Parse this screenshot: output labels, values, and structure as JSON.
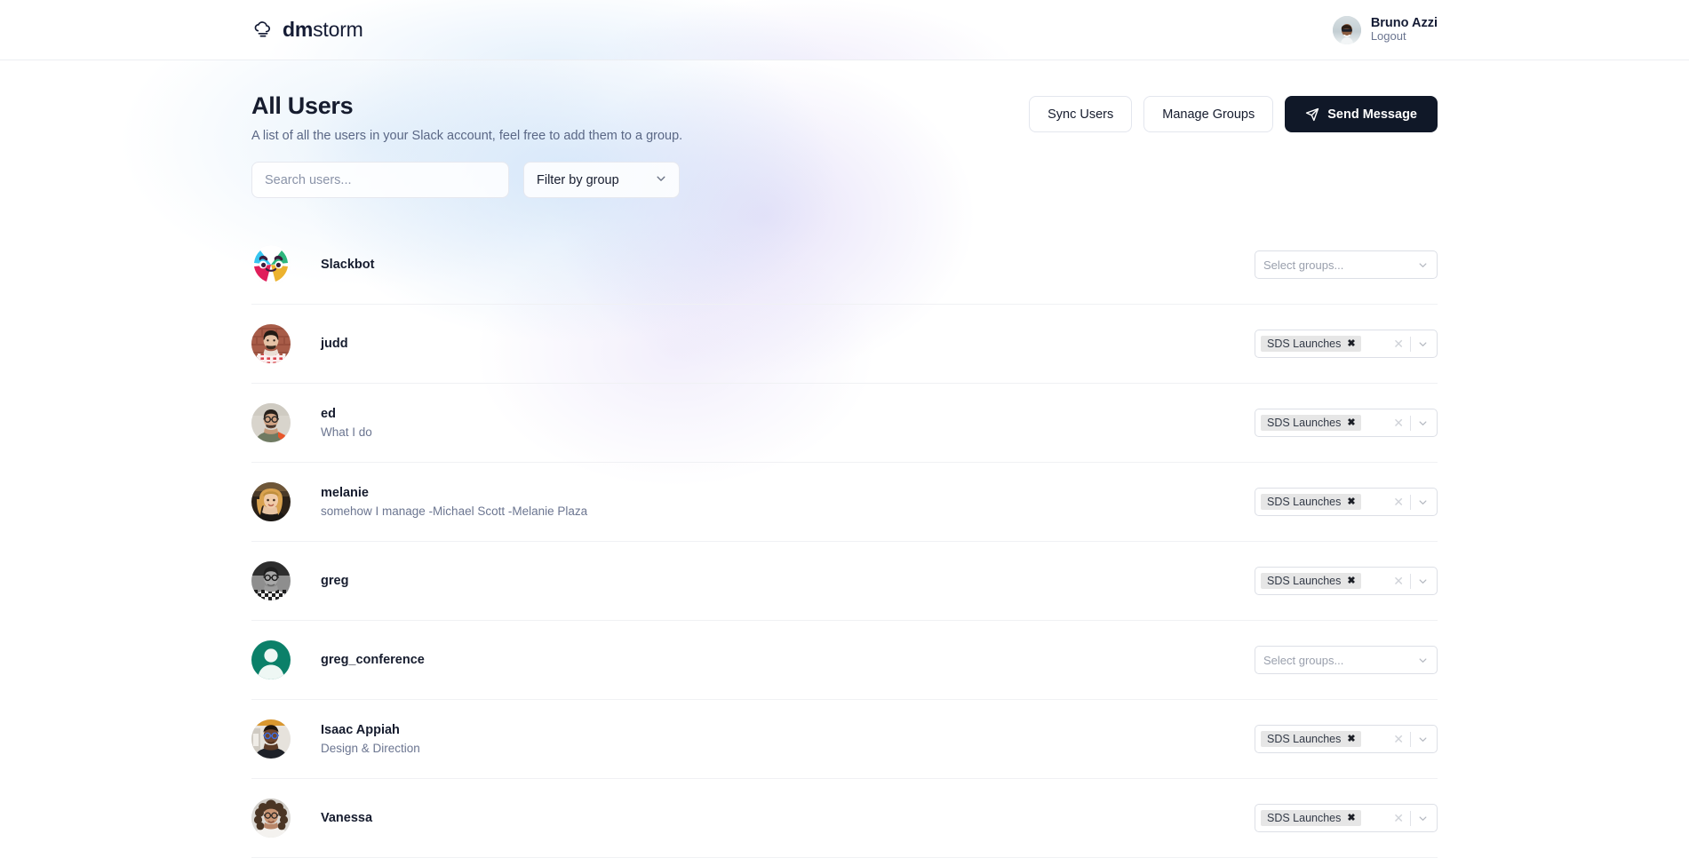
{
  "brand": {
    "name_bold": "dm",
    "name_light": "storm",
    "icon": "cloud-icon"
  },
  "account": {
    "name": "Bruno Azzi",
    "logout_label": "Logout",
    "avatar": "avatar-bruno-azzi"
  },
  "page": {
    "title": "All Users",
    "subtitle": "A list of all the users in your Slack account, feel free to add them to a group."
  },
  "actions": {
    "sync_users": "Sync Users",
    "manage_groups": "Manage Groups",
    "send_message": "Send Message",
    "send_message_icon": "paper-plane-icon",
    "primary_color": "#101828"
  },
  "filters": {
    "search_placeholder": "Search users...",
    "search_value": "",
    "group_filter_label": "Filter by group",
    "group_filter_icon": "chevron-down-icon"
  },
  "group_select": {
    "placeholder": "Select groups...",
    "tag_remove_glyph": "✖",
    "clear_glyph": "✕",
    "chevron_icon": "chevron-down-icon"
  },
  "users": [
    {
      "name": "Slackbot",
      "description": "",
      "avatar": "avatar-slackbot",
      "groups": []
    },
    {
      "name": "judd",
      "description": "",
      "avatar": "avatar-judd",
      "groups": [
        "SDS Launches"
      ]
    },
    {
      "name": "ed",
      "description": "What I do",
      "avatar": "avatar-ed",
      "groups": [
        "SDS Launches"
      ]
    },
    {
      "name": "melanie",
      "description": "somehow I manage -Michael Scott -Melanie Plaza",
      "avatar": "avatar-melanie",
      "groups": [
        "SDS Launches"
      ]
    },
    {
      "name": "greg",
      "description": "",
      "avatar": "avatar-greg",
      "groups": [
        "SDS Launches"
      ]
    },
    {
      "name": "greg_conference",
      "description": "",
      "avatar": "avatar-greg-conference",
      "groups": []
    },
    {
      "name": "Isaac Appiah",
      "description": "Design & Direction",
      "avatar": "avatar-isaac-appiah",
      "groups": [
        "SDS Launches"
      ]
    },
    {
      "name": "Vanessa",
      "description": "",
      "avatar": "avatar-vanessa",
      "groups": [
        "SDS Launches"
      ]
    }
  ]
}
